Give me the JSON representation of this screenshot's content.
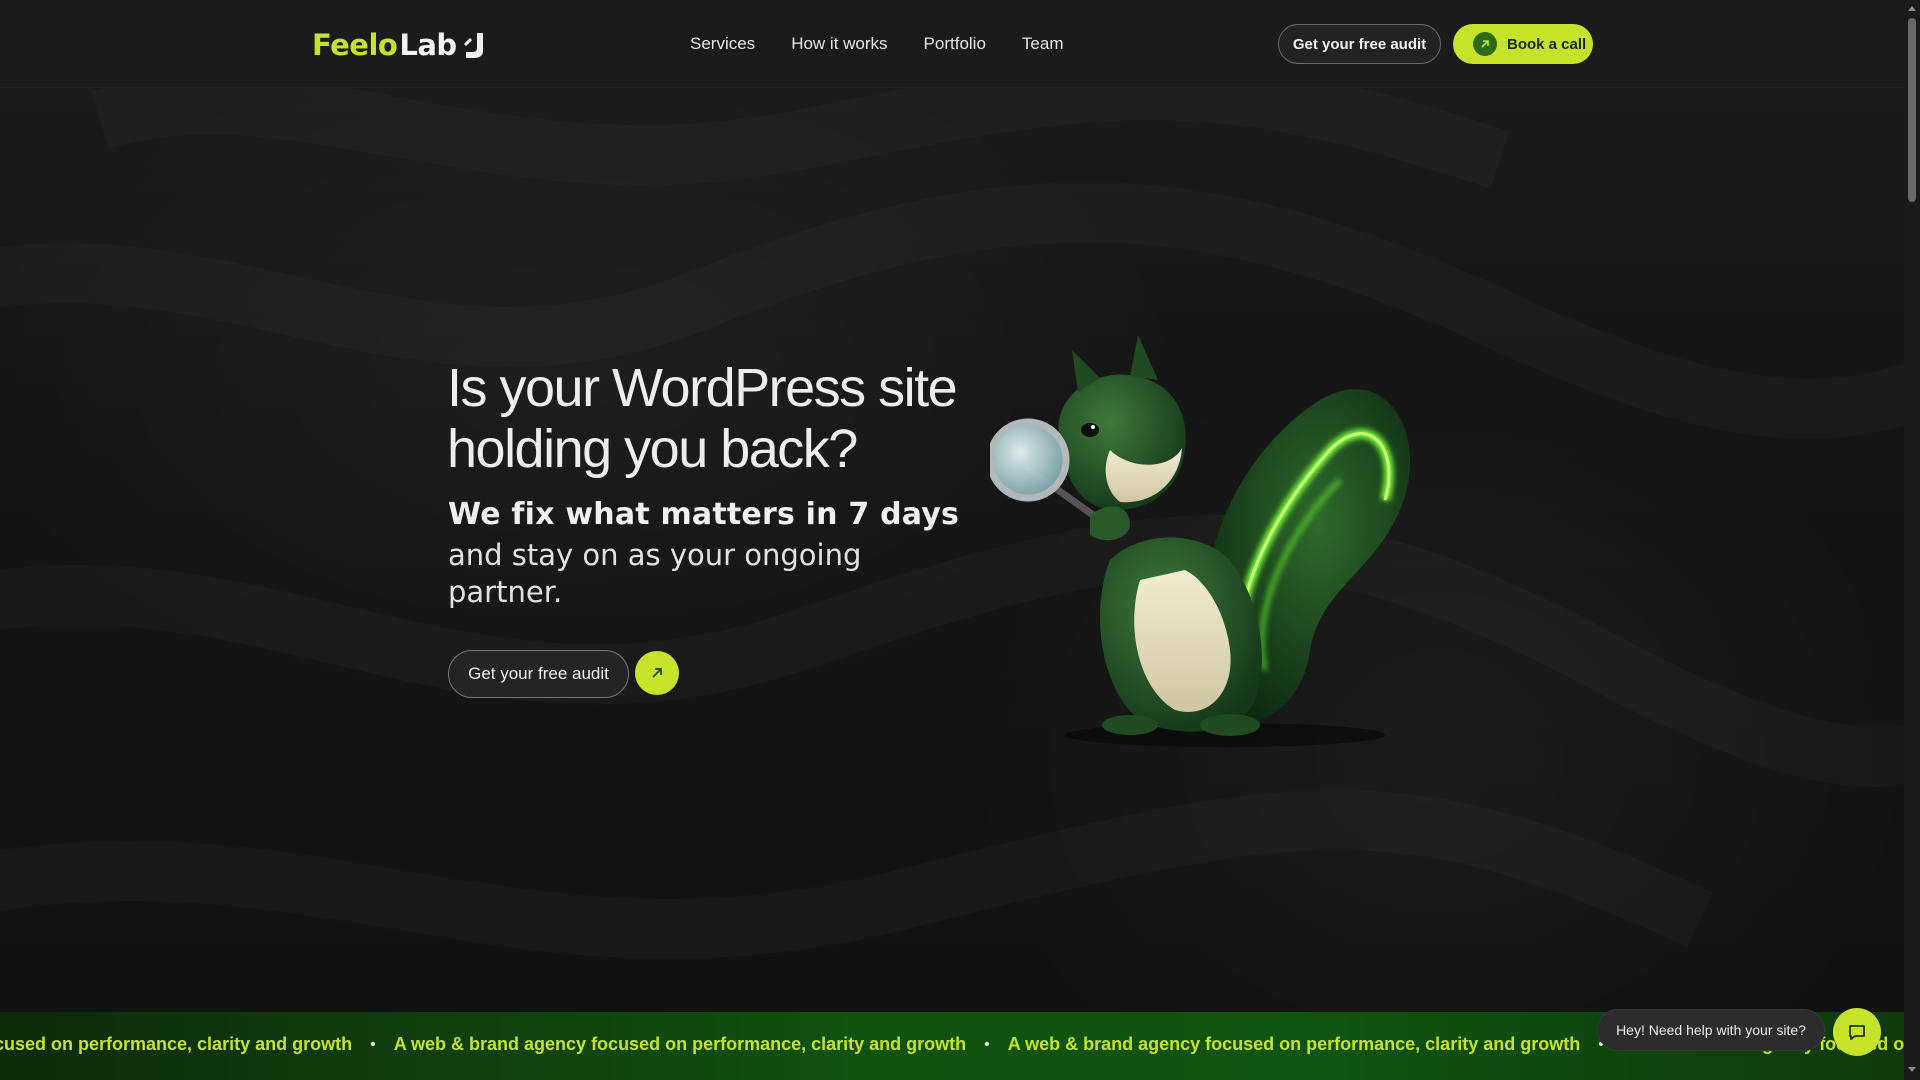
{
  "logo": {
    "part1": "Feelo",
    "part2": "Lab",
    "icon": "logo-mark-icon"
  },
  "nav": {
    "items": [
      {
        "label": "Services"
      },
      {
        "label": "How it works"
      },
      {
        "label": "Portfolio"
      },
      {
        "label": "Team"
      }
    ]
  },
  "header_actions": {
    "audit_label": "Get your free audit",
    "call_label": "Book a call",
    "call_icon": "arrow-up-right-icon"
  },
  "hero": {
    "title": "Is your WordPress site holding you back?",
    "subtitle_bold": "We fix what matters in 7 days",
    "subtitle": "and stay on as your ongoing partner.",
    "cta_label": "Get your free audit",
    "cta_icon": "arrow-up-right-icon",
    "illustration": "squirrel-with-magnifying-glass"
  },
  "marquee": {
    "items": [
      "ocused on performance, clarity and growth",
      "A web & brand agency focused on performance, clarity and growth",
      "A web & brand agency focused on performance, clarity and growth",
      "A web & brand agency focused on performance, clarity and growth"
    ],
    "separator": "•"
  },
  "chat": {
    "prompt": "Hey! Need help with your site?",
    "icon": "chat-bubble-icon"
  },
  "colors": {
    "accent": "#c6e32a",
    "background": "#131313",
    "marquee_bg": "#11520f"
  }
}
